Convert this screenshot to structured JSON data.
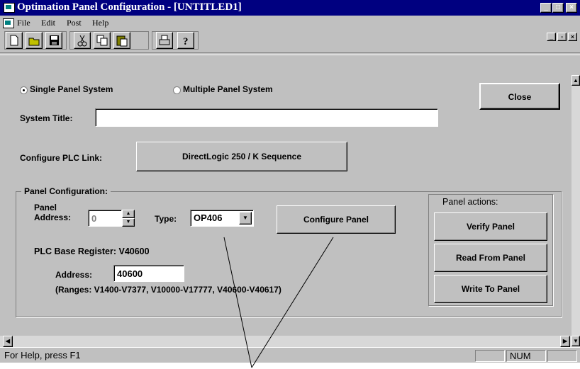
{
  "window": {
    "title": "Optimation Panel Configuration - [UNTITLED1]",
    "caption_buttons": [
      "_",
      "□",
      "×"
    ],
    "mdi_buttons": [
      "_",
      "▫",
      "×"
    ]
  },
  "menu": [
    "File",
    "Edit",
    "Post",
    "Help"
  ],
  "toolbar": {
    "icons": [
      "new-document-icon",
      "open-icon",
      "save-icon",
      "cut-icon",
      "copy-icon",
      "paste-icon",
      "print-icon",
      "help-icon"
    ]
  },
  "system_mode": {
    "single_label": "Single Panel System",
    "multiple_label": "Multiple Panel System",
    "selected": "single"
  },
  "close_label": "Close",
  "system_title": {
    "label": "System Title:",
    "value": ""
  },
  "plc_link": {
    "label": "Configure PLC Link:",
    "button": "DirectLogic 250 / K Sequence"
  },
  "panel_config": {
    "group_label": "Panel Configuration:",
    "address_label_1": "Panel",
    "address_label_2": "Address:",
    "address_value": "0",
    "type_label": "Type:",
    "type_value": "OP406",
    "configure_label": "Configure Panel",
    "plc_base_register": "PLC Base Register: V40600",
    "address_field_label": "Address:",
    "address_field_value": "40600",
    "ranges": "(Ranges: V1400-V7377, V10000-V17777, V40600-V40617)"
  },
  "panel_actions": {
    "label": "Panel actions:",
    "verify": "Verify Panel",
    "read": "Read From Panel",
    "write": "Write To Panel"
  },
  "status": {
    "help": "For Help, press F1",
    "num": "NUM"
  }
}
